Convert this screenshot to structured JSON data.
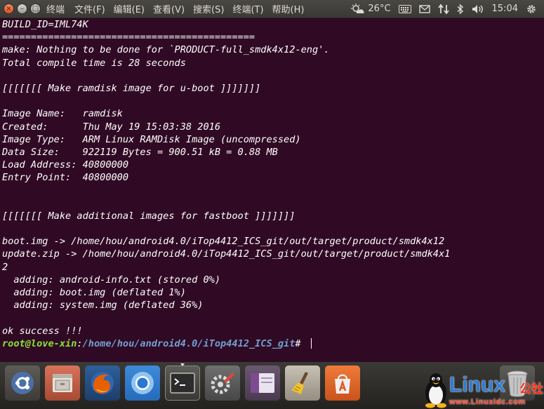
{
  "top_panel": {
    "window_buttons": {
      "close": "×",
      "minimize": "–",
      "maximize": "□"
    },
    "app_title": "终端",
    "menus": [
      {
        "label": "文件(F)"
      },
      {
        "label": "编辑(E)"
      },
      {
        "label": "查看(V)"
      },
      {
        "label": "搜索(S)"
      },
      {
        "label": "终端(T)"
      },
      {
        "label": "帮助(H)"
      }
    ],
    "weather": {
      "icon": "sun-cloud-icon",
      "temperature": "26°C"
    },
    "indicators": [
      "keyboard-icon",
      "mail-icon",
      "network-updown-icon",
      "bluetooth-icon",
      "volume-icon"
    ],
    "clock": "15:04",
    "session_icon": "gear-icon"
  },
  "terminal": {
    "lines": [
      "BUILD_ID=IML74K",
      "============================================",
      "make: Nothing to be done for `PRODUCT-full_smdk4x12-eng'.",
      "Total compile time is 28 seconds",
      "",
      "[[[[[[[ Make ramdisk image for u-boot ]]]]]]]",
      "",
      "Image Name:   ramdisk",
      "Created:      Thu May 19 15:03:38 2016",
      "Image Type:   ARM Linux RAMDisk Image (uncompressed)",
      "Data Size:    922119 Bytes = 900.51 kB = 0.88 MB",
      "Load Address: 40800000",
      "Entry Point:  40800000",
      "",
      "",
      "[[[[[[[ Make additional images for fastboot ]]]]]]]",
      "",
      "boot.img -> /home/hou/android4.0/iTop4412_ICS_git/out/target/product/smdk4x12",
      "update.zip -> /home/hou/android4.0/iTop4412_ICS_git/out/target/product/smdk4x1",
      "2",
      "  adding: android-info.txt (stored 0%)",
      "  adding: boot.img (deflated 1%)",
      "  adding: system.img (deflated 36%)",
      "",
      "ok success !!!"
    ],
    "prompt": {
      "user_host": "root@love-xin",
      "separator": ":",
      "path": "/home/hou/android4.0/iTop4412_ICS_git",
      "symbol": "# "
    }
  },
  "dock": {
    "items": [
      {
        "name": "ubuntu-dash-icon",
        "active": false
      },
      {
        "name": "file-manager-icon",
        "active": false
      },
      {
        "name": "firefox-icon",
        "active": false
      },
      {
        "name": "chromium-icon",
        "active": false
      },
      {
        "name": "terminal-icon",
        "active": true
      },
      {
        "name": "system-settings-icon",
        "active": false
      },
      {
        "name": "workspace-switcher-icon",
        "active": false
      },
      {
        "name": "bleachbit-icon",
        "active": false
      },
      {
        "name": "software-center-icon",
        "active": false
      },
      {
        "name": "trash-icon",
        "active": false
      }
    ]
  },
  "watermark": {
    "brand": "Linux",
    "cjk": "公社",
    "url": "www.Linuxidc.com"
  },
  "colors": {
    "terminal_bg": "#300a24",
    "prompt_user": "#8ae234",
    "prompt_path": "#729fcf",
    "panel_bg": "#3c3b37",
    "watermark_blue": "#2e7cd6",
    "watermark_red": "#ff2a10"
  }
}
